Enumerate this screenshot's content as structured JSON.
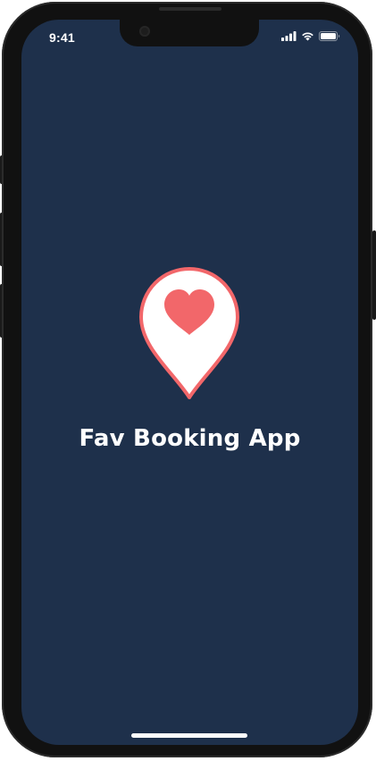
{
  "status_bar": {
    "time": "9:41",
    "icons": [
      "cellular-signal-icon",
      "wifi-icon",
      "battery-icon"
    ]
  },
  "splash": {
    "logo_icon": "location-pin-heart-icon",
    "app_name": "Fav Booking App"
  },
  "colors": {
    "background": "#1e304b",
    "accent": "#f2676a",
    "pin_fill": "#ffffff",
    "text": "#ffffff"
  }
}
